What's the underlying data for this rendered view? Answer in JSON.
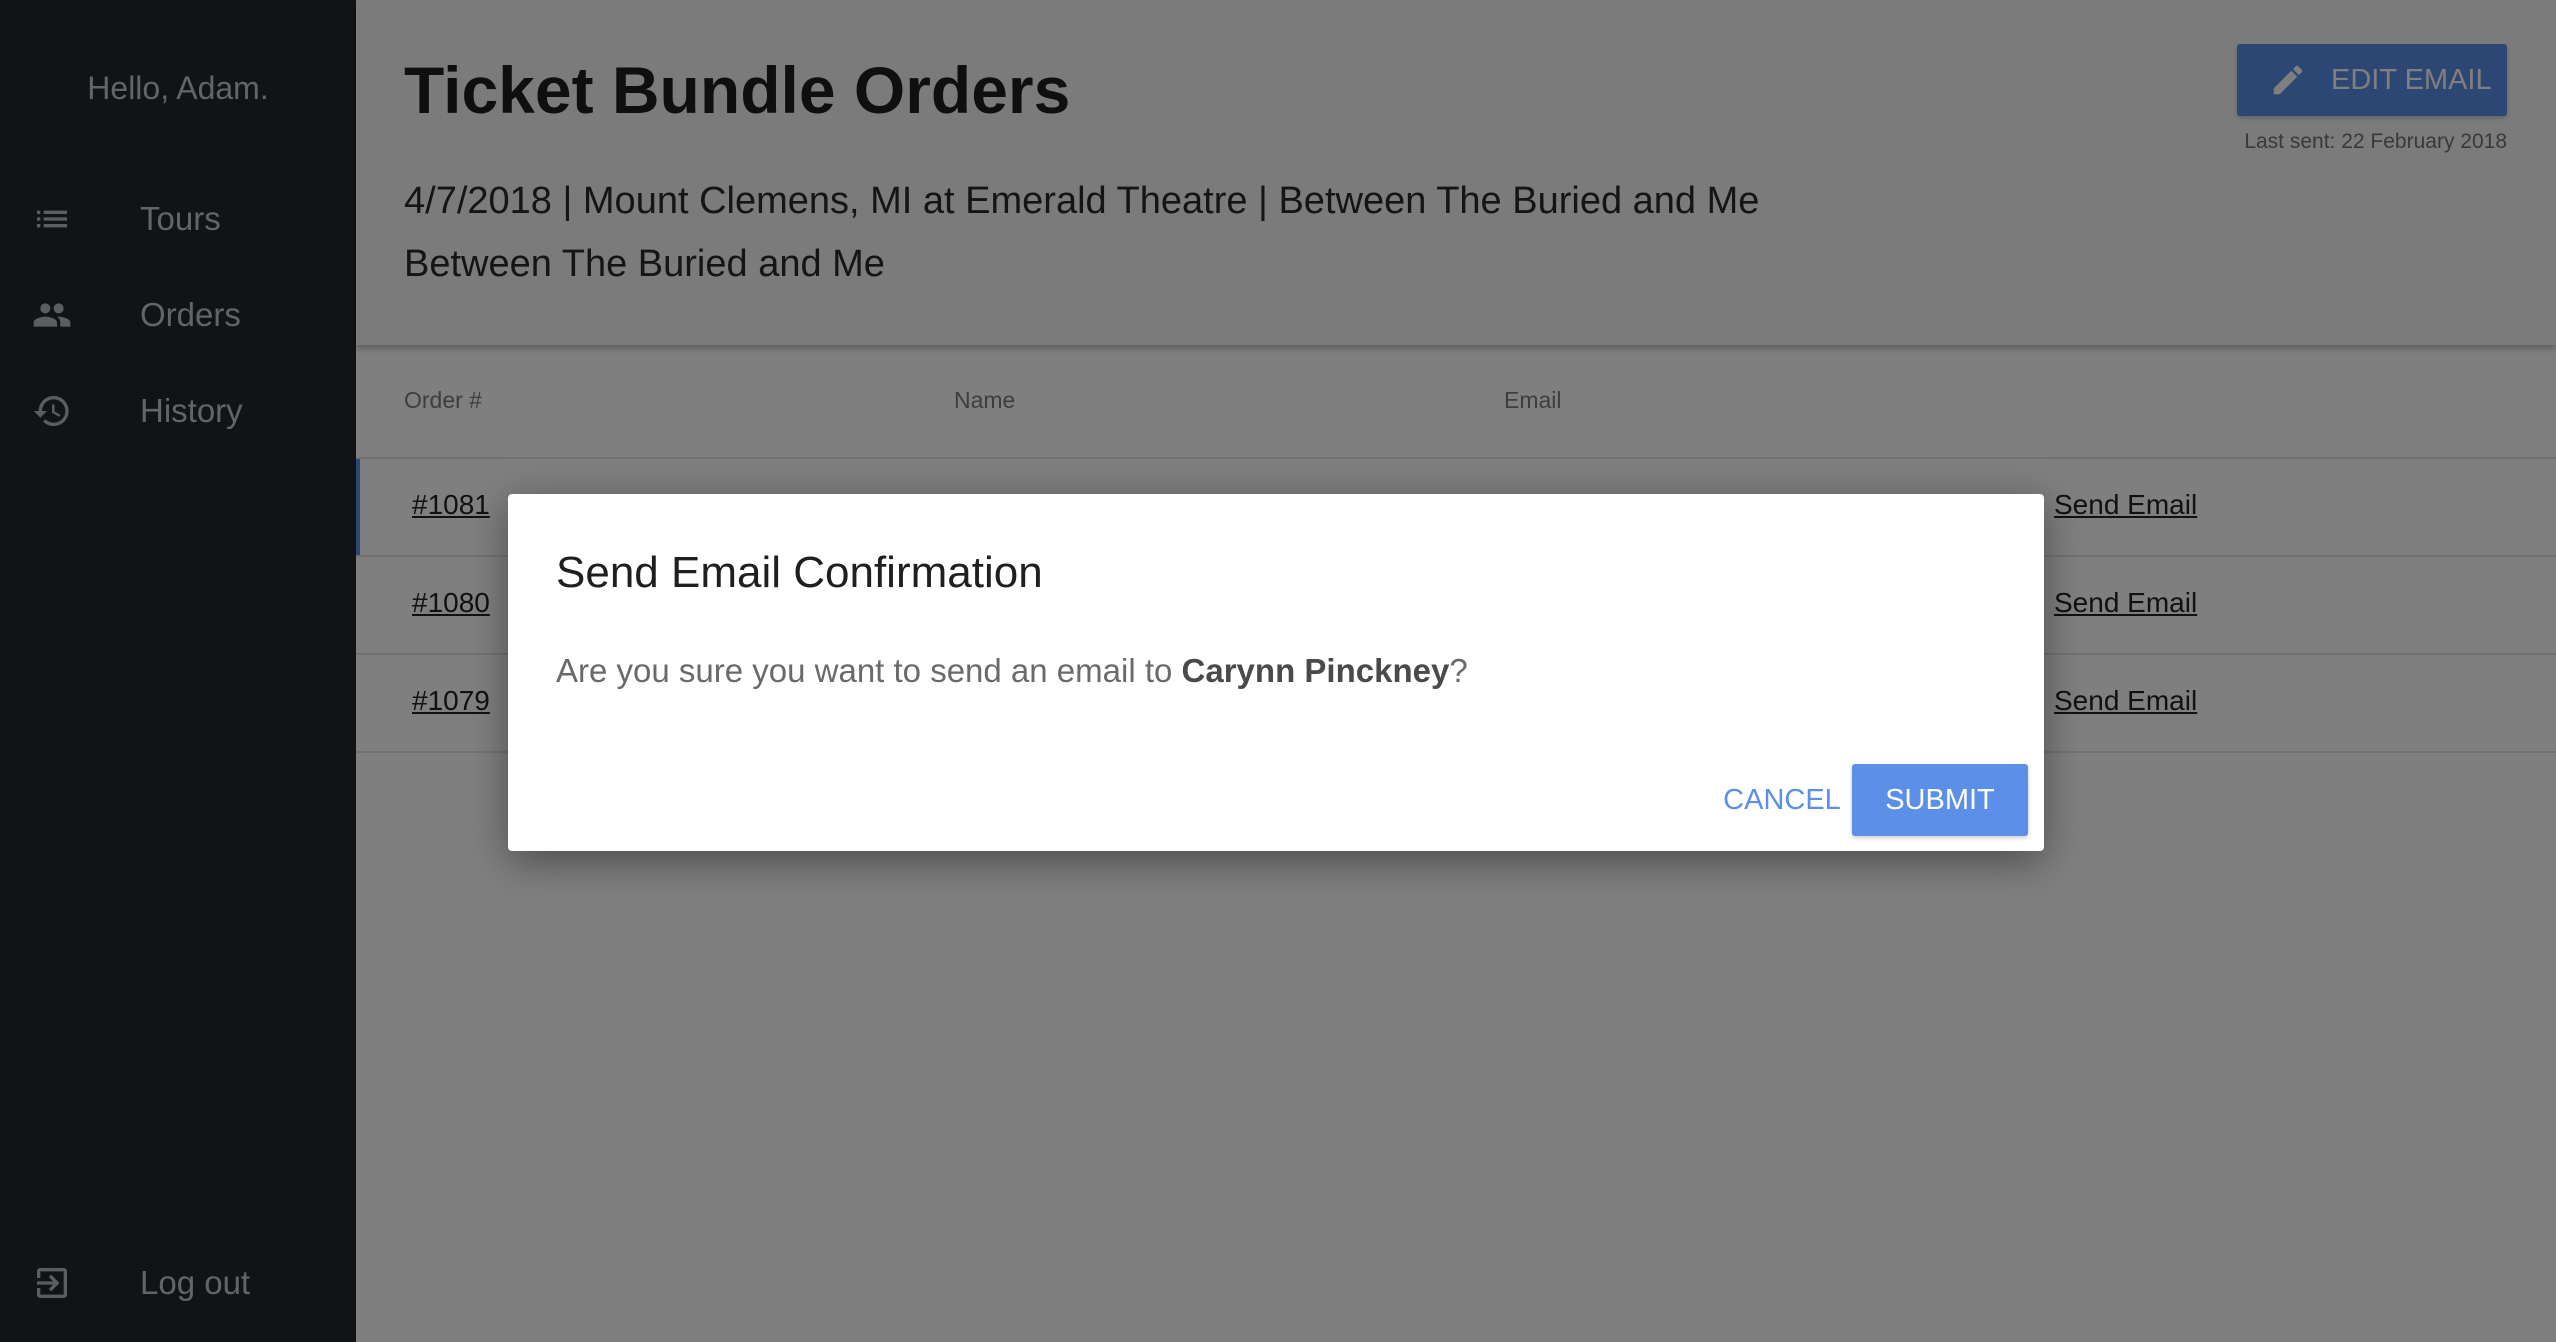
{
  "sidebar": {
    "greeting": "Hello, Adam.",
    "items": [
      {
        "label": "Tours",
        "icon": "list-icon"
      },
      {
        "label": "Orders",
        "icon": "people-icon"
      },
      {
        "label": "History",
        "icon": "history-icon"
      }
    ],
    "logout": {
      "label": "Log out",
      "icon": "logout-icon"
    }
  },
  "header": {
    "title": "Ticket Bundle Orders",
    "event_line": "4/7/2018 | Mount Clemens, MI at Emerald Theatre | Between The Buried and Me",
    "event_sub": "Between The Buried and Me",
    "edit_email_label": "EDIT EMAIL",
    "last_sent": "Last sent: 22 February 2018"
  },
  "table": {
    "columns": [
      "Order #",
      "Name",
      "Email"
    ],
    "rows": [
      {
        "order": "#1081",
        "action": "Send Email"
      },
      {
        "order": "#1080",
        "action": "Send Email"
      },
      {
        "order": "#1079",
        "action": "Send Email"
      }
    ]
  },
  "dialog": {
    "title": "Send Email Confirmation",
    "body_prefix": "Are you sure you want to send an email to ",
    "recipient": "Carynn Pinckney",
    "body_suffix": "?",
    "cancel_label": "CANCEL",
    "submit_label": "SUBMIT"
  },
  "colors": {
    "accent": "#5b8fe8",
    "sidebar_bg": "#22262f"
  }
}
